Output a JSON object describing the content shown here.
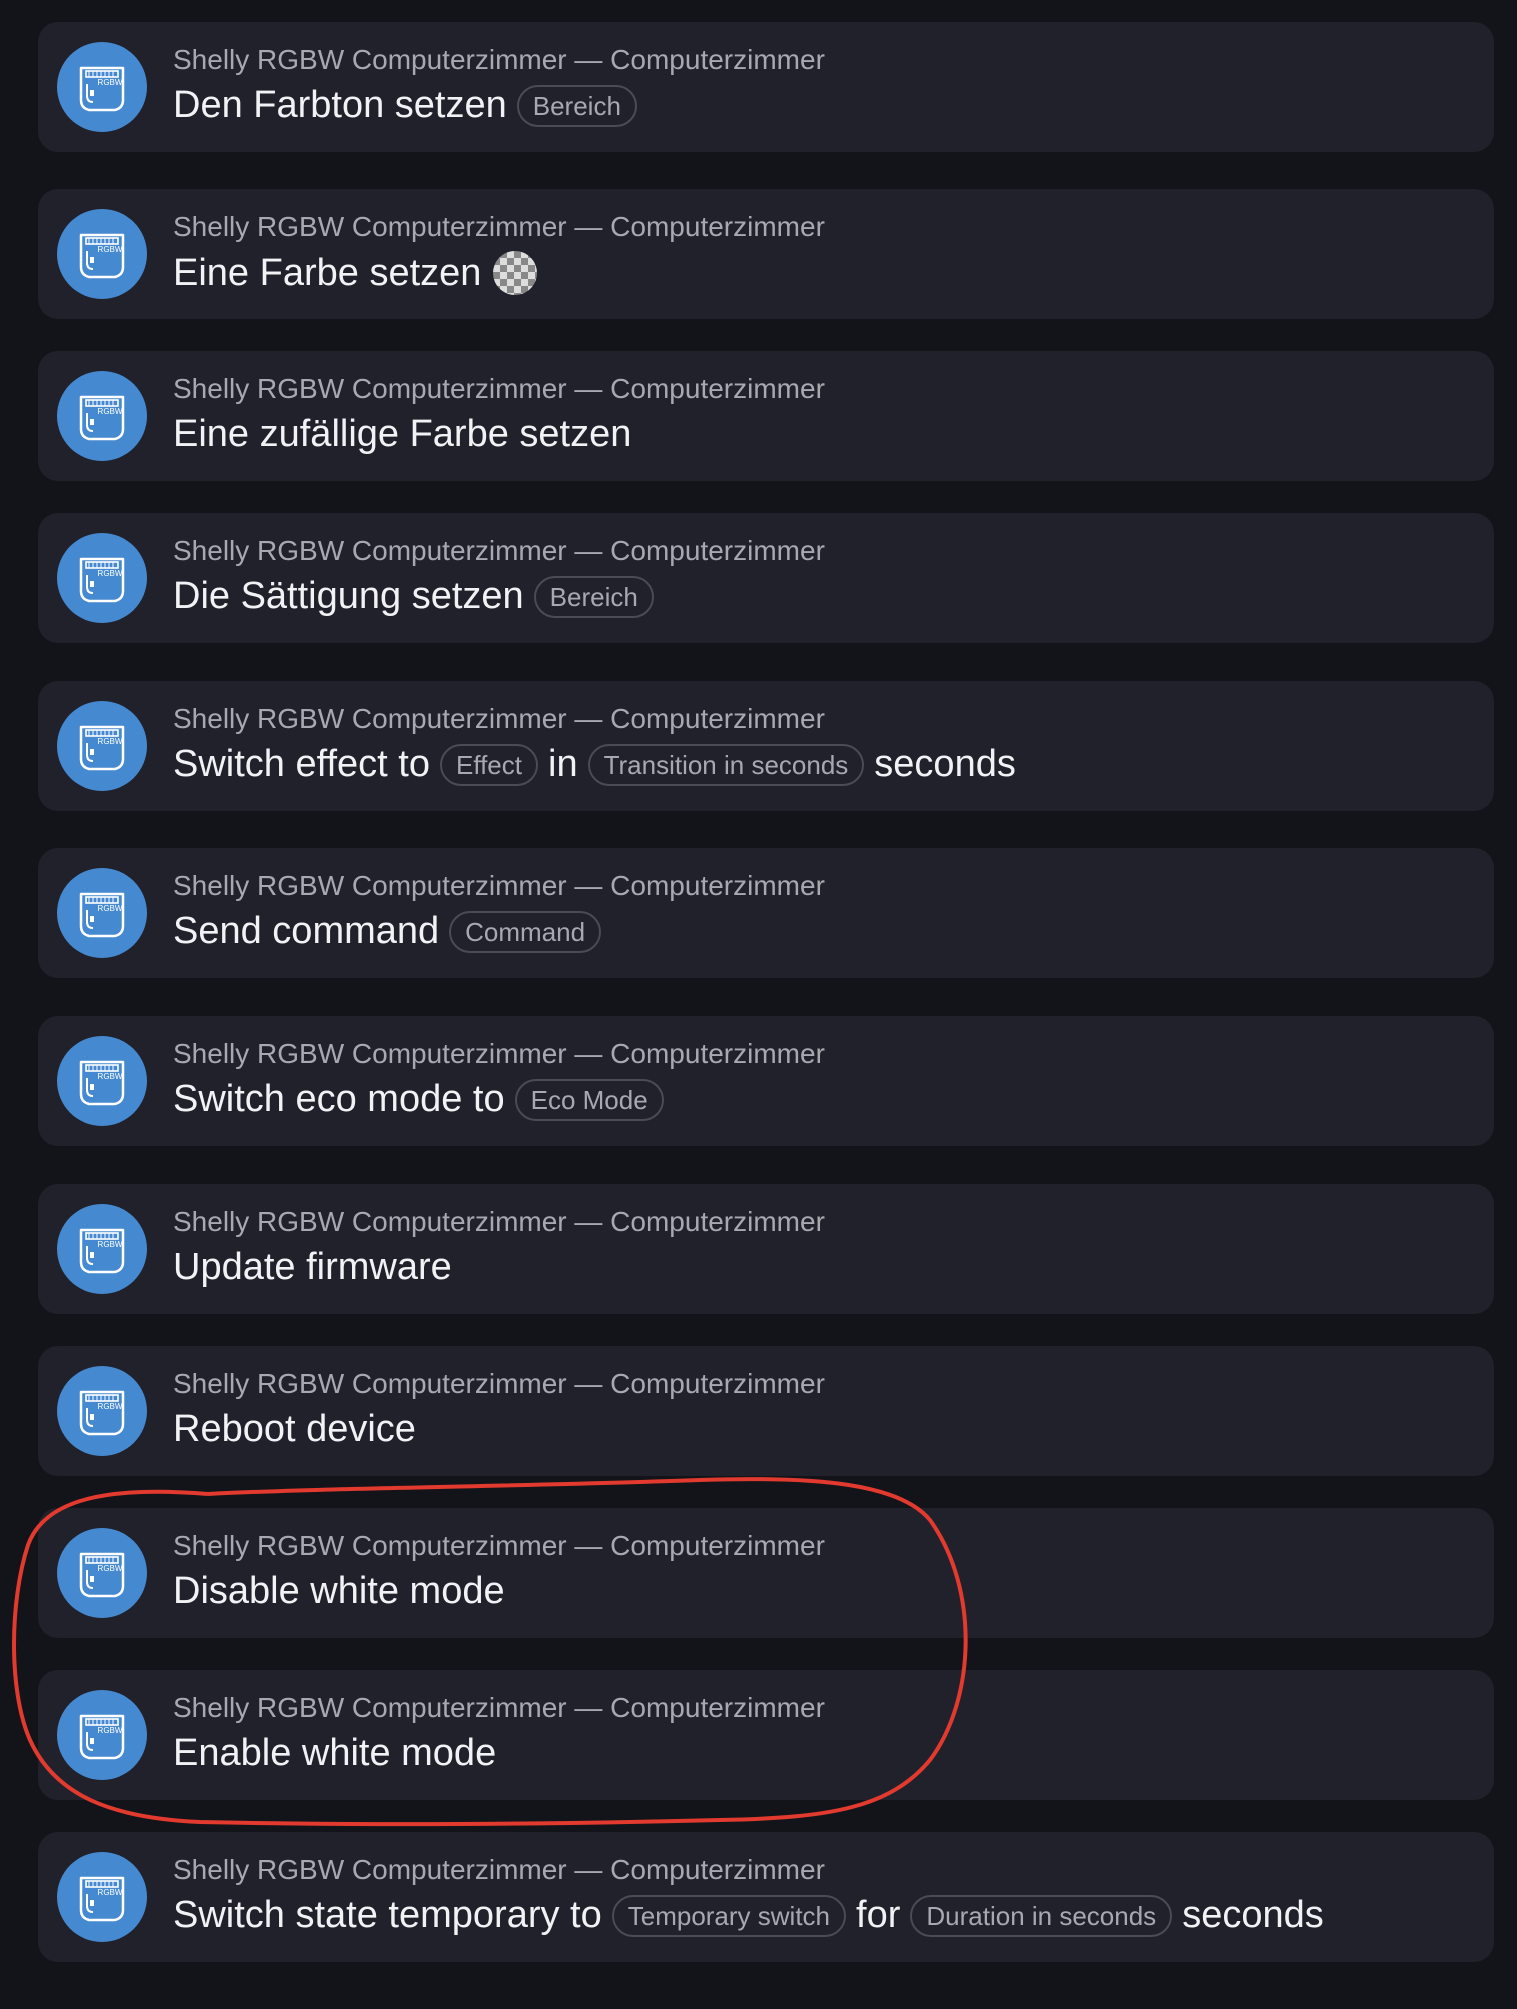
{
  "device_line": "Shelly RGBW Computerzimmer — Computerzimmer",
  "accent_color": "#4589d0",
  "highlight_color": "#e23a2e",
  "items": [
    {
      "parts": [
        {
          "text": "Den Farbton setzen"
        },
        {
          "chip": "Bereich"
        }
      ]
    },
    {
      "parts": [
        {
          "text": "Eine Farbe setzen"
        },
        {
          "icon": "color-swatch-icon"
        }
      ]
    },
    {
      "parts": [
        {
          "text": "Eine zufällige Farbe setzen"
        }
      ]
    },
    {
      "parts": [
        {
          "text": "Die Sättigung setzen"
        },
        {
          "chip": "Bereich"
        }
      ]
    },
    {
      "parts": [
        {
          "text": "Switch effect to"
        },
        {
          "chip": "Effect"
        },
        {
          "text": "in"
        },
        {
          "chip": "Transition in seconds"
        },
        {
          "text": "seconds"
        }
      ]
    },
    {
      "parts": [
        {
          "text": "Send command"
        },
        {
          "chip": "Command"
        }
      ]
    },
    {
      "parts": [
        {
          "text": "Switch eco mode to"
        },
        {
          "chip": "Eco Mode"
        }
      ]
    },
    {
      "parts": [
        {
          "text": "Update firmware"
        }
      ]
    },
    {
      "parts": [
        {
          "text": "Reboot device"
        }
      ]
    },
    {
      "parts": [
        {
          "text": "Disable white mode"
        }
      ]
    },
    {
      "parts": [
        {
          "text": "Enable white mode"
        }
      ]
    },
    {
      "parts": [
        {
          "text": "Switch state temporary to"
        },
        {
          "chip": "Temporary switch"
        },
        {
          "text": "for"
        },
        {
          "chip": "Duration in seconds"
        },
        {
          "text": "seconds"
        }
      ]
    }
  ]
}
